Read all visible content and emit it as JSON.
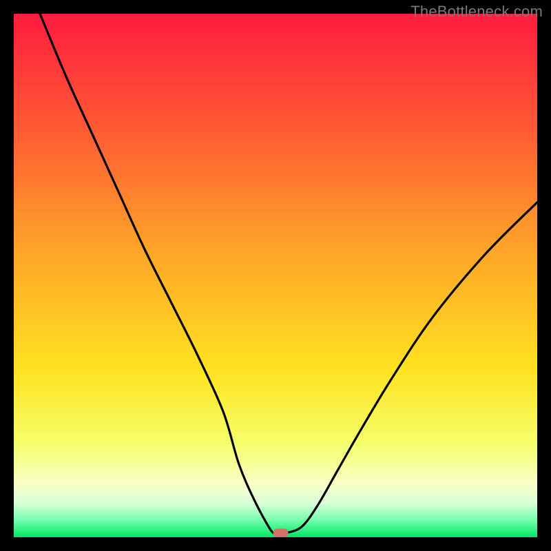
{
  "watermark": "TheBottleneck.com",
  "chart_data": {
    "type": "line",
    "title": "",
    "xlabel": "",
    "ylabel": "",
    "xlim": [
      0,
      100
    ],
    "ylim": [
      0,
      100
    ],
    "x": [
      5,
      10,
      15,
      20,
      25,
      30,
      35,
      40,
      43,
      46,
      49,
      50,
      51,
      52,
      55,
      58,
      62,
      66,
      72,
      80,
      90,
      100
    ],
    "values": [
      100,
      88,
      77,
      66,
      55,
      45,
      35,
      24,
      14,
      7,
      1.5,
      0.8,
      0.8,
      0.8,
      2,
      6,
      13,
      20,
      30,
      42,
      54,
      64
    ],
    "optimal_x": 51,
    "optimal_y": 0.8,
    "gradient_stops": [
      {
        "offset": 0.0,
        "color": "#ff1c3f"
      },
      {
        "offset": 0.22,
        "color": "#ff5a34"
      },
      {
        "offset": 0.45,
        "color": "#ffa428"
      },
      {
        "offset": 0.68,
        "color": "#ffe220"
      },
      {
        "offset": 0.82,
        "color": "#f5ff6a"
      },
      {
        "offset": 0.9,
        "color": "#f8ffc8"
      },
      {
        "offset": 0.935,
        "color": "#d8ffd8"
      },
      {
        "offset": 0.965,
        "color": "#7dffb0"
      },
      {
        "offset": 1.0,
        "color": "#00e865"
      }
    ],
    "marker_color": "#d4726a"
  }
}
